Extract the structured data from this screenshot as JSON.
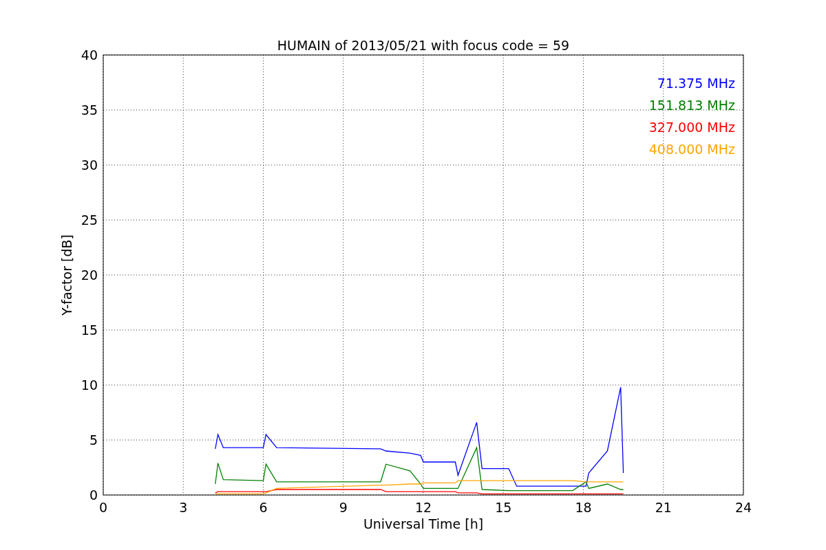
{
  "plot": {
    "chart_data": {
      "type": "line",
      "title": "HUMAIN of 2013/05/21 with focus code = 59",
      "xlabel": "Universal Time [h]",
      "ylabel": "Y-factor [dB]",
      "x": [
        4.2,
        4.3,
        4.5,
        6.0,
        6.1,
        6.5,
        10.4,
        10.6,
        11.5,
        11.9,
        12.0,
        13.2,
        13.3,
        14.0,
        14.2,
        15.2,
        15.5,
        17.6,
        18.1,
        18.2,
        18.9,
        19.4,
        19.5
      ],
      "series": [
        {
          "name": "71.375 MHz",
          "color": "#0000ff",
          "values": [
            4.2,
            5.5,
            4.3,
            4.3,
            5.5,
            4.3,
            4.2,
            4.0,
            3.8,
            3.6,
            3.0,
            3.0,
            1.8,
            6.6,
            2.4,
            2.4,
            0.8,
            0.8,
            0.8,
            2.0,
            4.0,
            9.8,
            2.0
          ]
        },
        {
          "name": "151.813 MHz",
          "color": "#008000",
          "values": [
            1.0,
            2.9,
            1.4,
            1.3,
            2.8,
            1.2,
            1.2,
            2.8,
            2.2,
            1.0,
            0.6,
            0.6,
            0.6,
            4.3,
            0.5,
            0.4,
            0.4,
            0.4,
            1.2,
            0.6,
            1.0,
            0.5,
            0.5
          ]
        },
        {
          "name": "327.000 MHz",
          "color": "#ff0000",
          "values": [
            0.2,
            0.3,
            0.3,
            0.3,
            0.3,
            0.5,
            0.5,
            0.3,
            0.3,
            0.3,
            0.3,
            0.3,
            0.2,
            0.2,
            0.1,
            0.1,
            0.1,
            0.1,
            0.1,
            0.1,
            0.1,
            0.1,
            0.1
          ]
        },
        {
          "name": "408.000 MHz",
          "color": "#ffa500",
          "values": [
            0.1,
            0.1,
            0.1,
            0.1,
            0.2,
            0.6,
            0.9,
            0.9,
            1.0,
            1.0,
            1.1,
            1.1,
            1.3,
            1.3,
            1.3,
            1.3,
            1.3,
            1.3,
            1.2,
            1.2,
            1.2,
            1.2,
            1.2
          ]
        }
      ],
      "grid": true,
      "xlim": [
        0,
        24
      ],
      "ylim": [
        0,
        40
      ],
      "xticks": [
        0,
        3,
        6,
        9,
        12,
        15,
        18,
        21,
        24
      ],
      "yticks": [
        0,
        5,
        10,
        15,
        20,
        25,
        30,
        35,
        40
      ]
    }
  }
}
